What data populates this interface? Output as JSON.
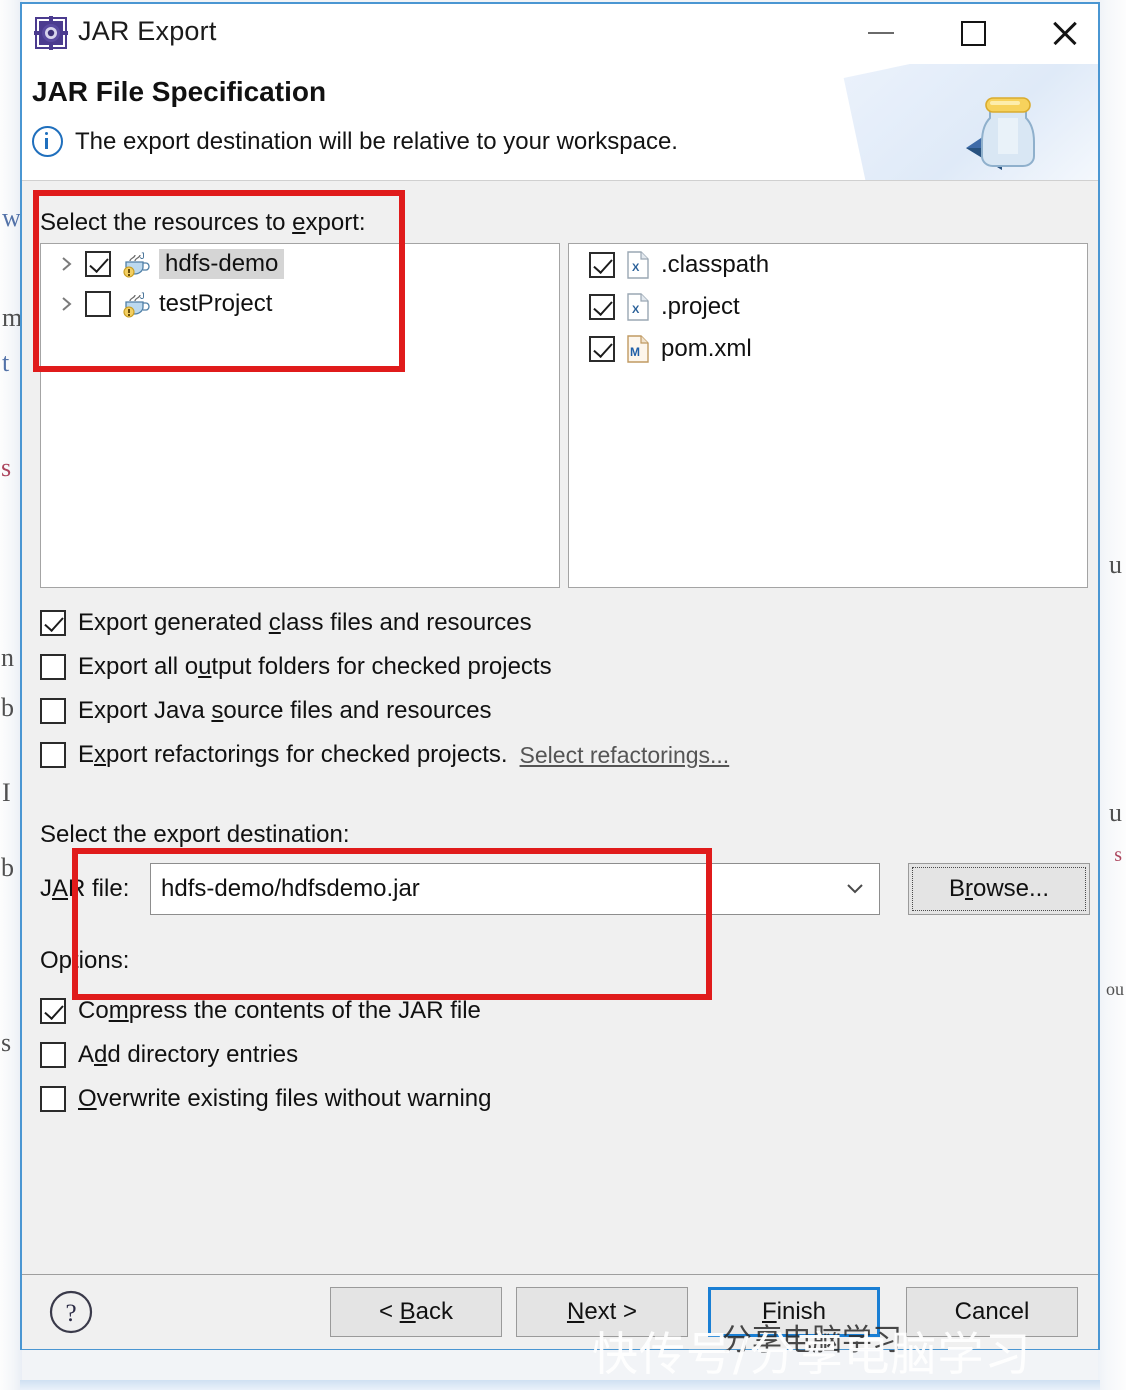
{
  "window": {
    "title": "JAR Export",
    "icon": "jar-export-icon",
    "minimize_label": "–",
    "maximize_label": "□",
    "close_label": "✕"
  },
  "banner": {
    "title": "JAR File Specification",
    "message": "The export destination will be relative to your workspace.",
    "info_icon": "info-icon",
    "graphic": "jar-jar-icon"
  },
  "resources": {
    "label_prefix": "Select the resources to ",
    "label_mnemonic": "e",
    "label_suffix": "xport:",
    "tree": [
      {
        "name": "hdfs-demo",
        "checked": true,
        "selected": true,
        "expandable": true,
        "icon": "java-project-icon"
      },
      {
        "name": "testProject",
        "checked": false,
        "selected": false,
        "expandable": true,
        "icon": "java-project-icon"
      }
    ],
    "files": [
      {
        "name": ".classpath",
        "checked": true,
        "icon": "xml-file-icon",
        "badge": "X"
      },
      {
        "name": ".project",
        "checked": true,
        "icon": "xml-file-icon",
        "badge": "X"
      },
      {
        "name": "pom.xml",
        "checked": true,
        "icon": "maven-file-icon",
        "badge": "M"
      }
    ]
  },
  "export_options": [
    {
      "pre": "Export generated ",
      "mnemonic": "c",
      "post": "lass files and resources",
      "checked": true,
      "name": "export-generated-class-files"
    },
    {
      "pre": "Export all o",
      "mnemonic": "u",
      "post": "tput folders for checked projects",
      "checked": false,
      "name": "export-all-output-folders"
    },
    {
      "pre": "Export Java ",
      "mnemonic": "s",
      "post": "ource files and resources",
      "checked": false,
      "name": "export-java-source-files"
    },
    {
      "pre": "Export refactorings for checked projects.",
      "mnemonic": "",
      "post": "",
      "checked": false,
      "name": "export-refactorings",
      "link": "Select refactorings..."
    }
  ],
  "destination": {
    "section_label": "Select the export destination:",
    "jar_file_label_pre": "J",
    "jar_file_label_mnemonic": "A",
    "jar_file_label_post": "R file:",
    "jar_file_value": "hdfs-demo/hdfsdemo.jar",
    "jar_file_placeholder": "",
    "browse_pre": "B",
    "browse_mnemonic": "r",
    "browse_post": "owse..."
  },
  "options": {
    "section_label": "Options:",
    "items": [
      {
        "pre": "Co",
        "mnemonic": "m",
        "post": "press the contents of the JAR file",
        "checked": true,
        "name": "compress-contents"
      },
      {
        "pre": "A",
        "mnemonic": "d",
        "post": "d directory entries",
        "checked": false,
        "name": "add-directory-entries"
      },
      {
        "pre": "",
        "mnemonic": "O",
        "post": "verwrite existing files without warning",
        "checked": false,
        "name": "overwrite-existing-files"
      }
    ]
  },
  "footer": {
    "help_icon": "help-question-icon",
    "back_pre": "< ",
    "back_mnemonic": "B",
    "back_post": "ack",
    "next_pre": "",
    "next_mnemonic": "N",
    "next_post": "ext >",
    "finish_pre": "",
    "finish_mnemonic": "F",
    "finish_post": "inish",
    "cancel_pre": "",
    "cancel_mnemonic": "",
    "cancel_post": "Cancel"
  },
  "watermark": {
    "text": "快传号/分享电脑学习",
    "overlay_text": "分享电脑学习"
  },
  "annotations": {
    "box1": "highlight-resources-section",
    "box2": "highlight-jar-file-section"
  },
  "colors": {
    "accent_border": "#4a96d2",
    "annotation_red": "#e01b1b",
    "focus_blue": "#1a7fd4",
    "dialog_bg": "#f0f0f0"
  },
  "background_fragments": [
    "w",
    "m",
    "t",
    "s",
    "n",
    "b",
    "I",
    "b",
    "u",
    "s"
  ]
}
